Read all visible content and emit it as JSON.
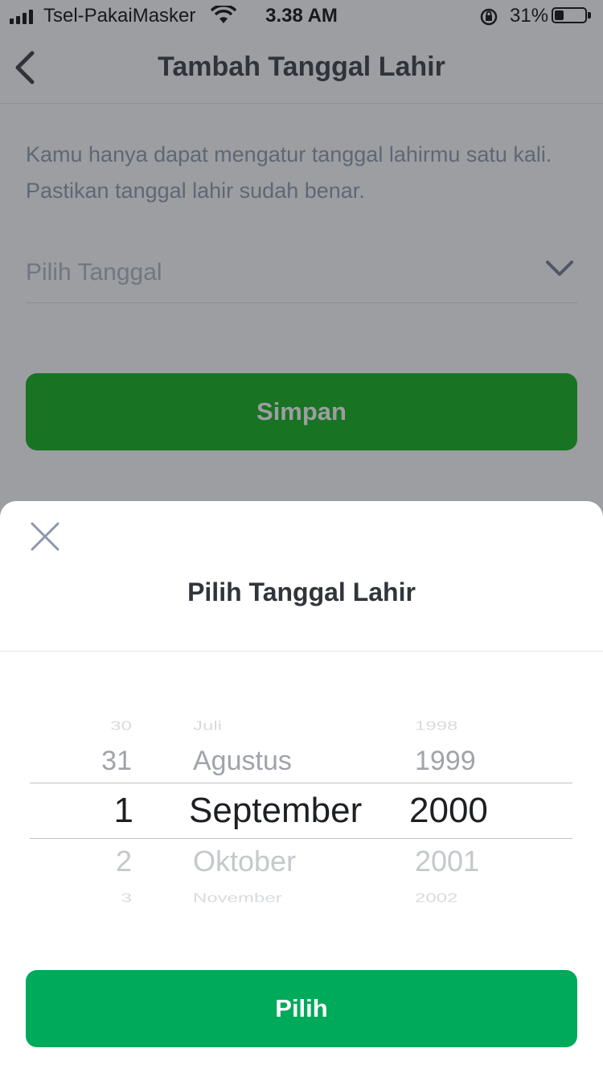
{
  "status_bar": {
    "carrier": "Tsel-PakaiMasker",
    "time": "3.38 AM",
    "battery_percent": "31%",
    "battery_level": 0.31
  },
  "nav": {
    "back_icon": "chevron-left-icon",
    "title": "Tambah Tanggal Lahir"
  },
  "info_text": "Kamu hanya dapat mengatur tanggal lahirmu satu kali. Pastikan tanggal lahir sudah benar.",
  "date_select": {
    "placeholder": "Pilih Tanggal",
    "icon": "chevron-down-icon"
  },
  "save_button": {
    "label": "Simpan",
    "color": "#03ac0e"
  },
  "sheet": {
    "close_icon": "close-icon",
    "title": "Pilih Tanggal Lahir",
    "picker": {
      "days": [
        "30",
        "31",
        "1",
        "2",
        "3"
      ],
      "months": [
        "Juli",
        "Agustus",
        "September",
        "Oktober",
        "November"
      ],
      "years": [
        "1998",
        "1999",
        "2000",
        "2001",
        "2002"
      ],
      "selected": {
        "day": "1",
        "month": "September",
        "year": "2000"
      }
    },
    "confirm_button": {
      "label": "Pilih",
      "color": "#00aa5b"
    }
  }
}
